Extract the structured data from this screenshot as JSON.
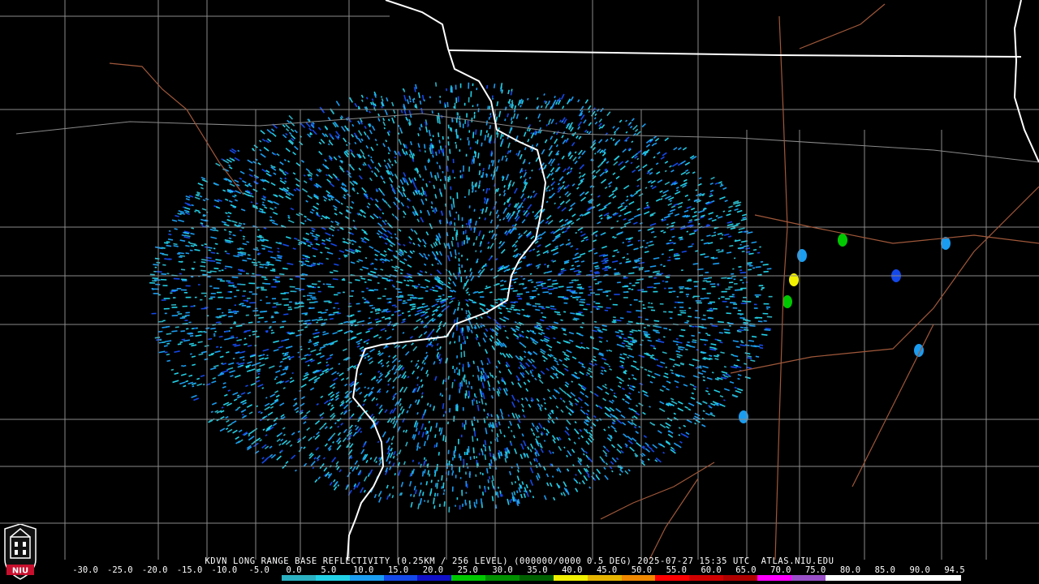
{
  "product_caption": "KDVN LONG RANGE BASE REFLECTIVITY (0.25KM / 256 LEVEL) (000000/0000 0.5 DEG) 2025-07-27 15:35 UTC  ATLAS.NIU.EDU",
  "logo_text": "NIU",
  "legend": {
    "ticks": [
      "-30.0",
      "-25.0",
      "-20.0",
      "-15.0",
      "-10.0",
      "-5.0",
      "0.0",
      "5.0",
      "10.0",
      "15.0",
      "20.0",
      "25.0",
      "30.0",
      "35.0",
      "40.0",
      "45.0",
      "50.0",
      "55.0",
      "60.0",
      "65.0",
      "70.0",
      "75.0",
      "80.0",
      "85.0",
      "90.0",
      "94.5"
    ],
    "colors": [
      "#000000",
      "#000000",
      "#000000",
      "#000000",
      "#000000",
      "#000000",
      "#2ab0c0",
      "#22d0e6",
      "#1a9cf0",
      "#1448e8",
      "#1010c8",
      "#00c800",
      "#009000",
      "#006000",
      "#f0f000",
      "#e6b400",
      "#f08800",
      "#ff0000",
      "#d00000",
      "#b00000",
      "#ff00ff",
      "#9a50c8",
      "#ffffff",
      "#ffffff",
      "#ffffff",
      "#ffffff"
    ]
  },
  "map_colors": {
    "background": "#000000",
    "county_lines": "#8a8a8a",
    "state_lines": "#ffffff",
    "highways": "#a0583a"
  }
}
